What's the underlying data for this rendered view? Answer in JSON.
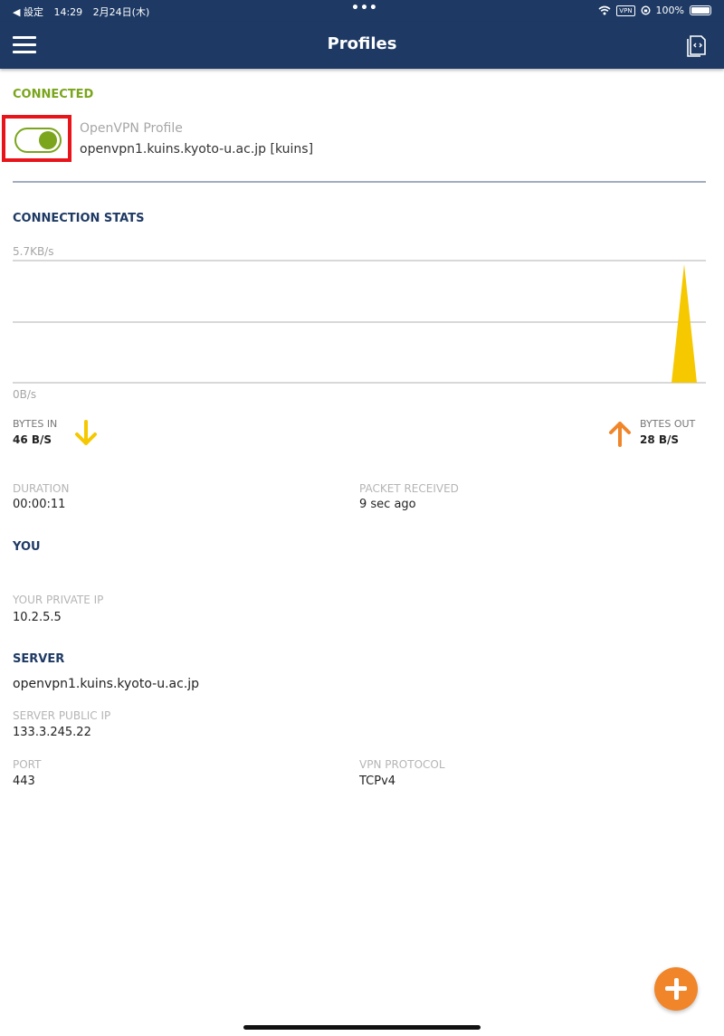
{
  "status_bar": {
    "back_label": "◀ 設定",
    "time": "14:29",
    "date": "2月24日(木)",
    "multitask_dots": "•••",
    "battery": "100%"
  },
  "nav": {
    "title": "Profiles",
    "menu_icon": "hamburger-icon",
    "import_icon": "import-profile-icon"
  },
  "connection": {
    "status": "CONNECTED",
    "toggle_on": true,
    "profile_type": "OpenVPN Profile",
    "profile_name": "openvpn1.kuins.kyoto-u.ac.jp [kuins]"
  },
  "stats": {
    "title": "CONNECTION STATS",
    "max_label": "5.7KB/s",
    "min_label": "0B/s",
    "bytes_in_label": "BYTES IN",
    "bytes_in_value": "46 B/S",
    "bytes_out_label": "BYTES OUT",
    "bytes_out_value": "28 B/S",
    "duration_label": "DURATION",
    "duration_value": "00:00:11",
    "packet_label": "PACKET RECEIVED",
    "packet_value": "9 sec ago"
  },
  "you": {
    "title": "YOU",
    "private_ip_label": "YOUR PRIVATE IP",
    "private_ip": "10.2.5.5"
  },
  "server": {
    "title": "SERVER",
    "host": "openvpn1.kuins.kyoto-u.ac.jp",
    "public_ip_label": "SERVER PUBLIC IP",
    "public_ip": "133.3.245.22",
    "port_label": "PORT",
    "port": "443",
    "protocol_label": "VPN PROTOCOL",
    "protocol": "TCPv4"
  },
  "colors": {
    "nav_bg": "#1e3a64",
    "connected_green": "#7aa51c",
    "highlight_red": "#e8141a",
    "bytes_in_yellow": "#f5c800",
    "bytes_out_orange": "#f0852a"
  }
}
